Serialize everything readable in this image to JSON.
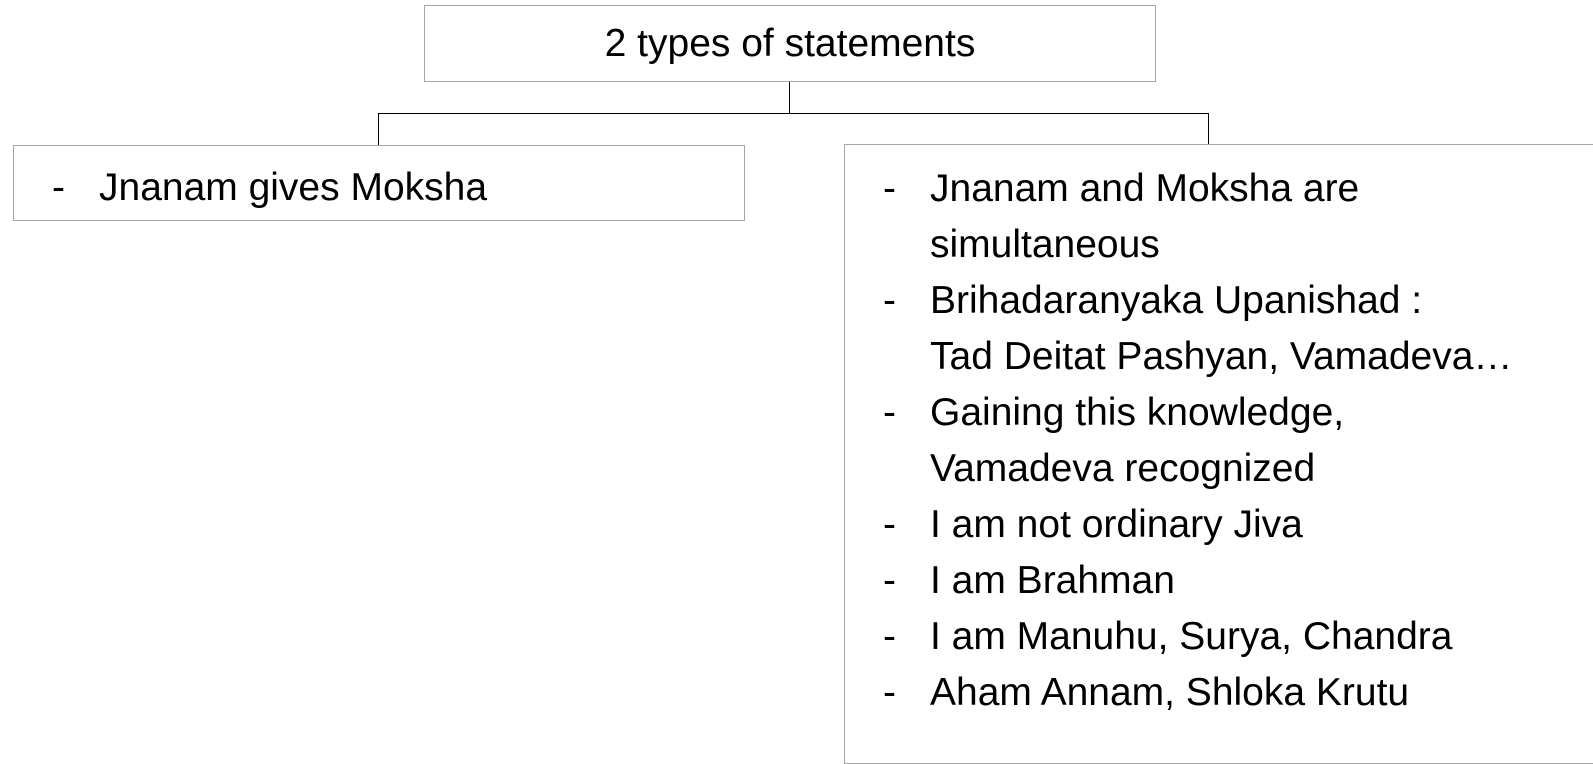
{
  "root": {
    "label": "2 types of statements"
  },
  "left_branch": {
    "items": [
      {
        "dash": "-",
        "lines": [
          "Jnanam gives Moksha"
        ]
      }
    ]
  },
  "right_branch": {
    "items": [
      {
        "dash": "-",
        "lines": [
          "Jnanam and Moksha are",
          "simultaneous"
        ]
      },
      {
        "dash": "-",
        "lines": [
          "Brihadaranyaka Upanishad :",
          "Tad Deitat Pashyan, Vamadeva…"
        ]
      },
      {
        "dash": "-",
        "lines": [
          "Gaining this knowledge,",
          "Vamadeva recognized"
        ]
      },
      {
        "dash": "-",
        "lines": [
          "I am not ordinary Jiva"
        ]
      },
      {
        "dash": "-",
        "lines": [
          "I am Brahman"
        ]
      },
      {
        "dash": "-",
        "lines": [
          "I am Manuhu, Surya, Chandra"
        ]
      },
      {
        "dash": "-",
        "lines": [
          "Aham Annam, Shloka Krutu"
        ]
      }
    ]
  }
}
